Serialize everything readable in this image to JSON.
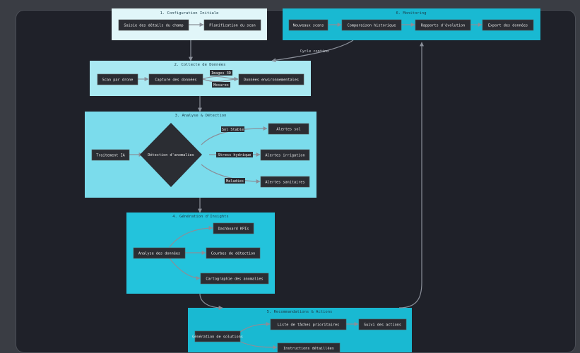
{
  "clusters": {
    "c1": "1. Configuration Initiale",
    "c2": "2. Collecte de Données",
    "c3": "3. Analyse & Détection",
    "c4": "4. Génération d'Insights",
    "c5": "5. Recommandations & Actions",
    "c6": "6. Monitoring"
  },
  "nodes": {
    "saisie": "Saisie des détails du champ",
    "planif": "Planification du scan",
    "scan": "Scan par drone",
    "capture": "Capture des données",
    "envdata": "Données environnementales",
    "traitement": "Traitement IA",
    "anomalies": "Détection d'anomalies",
    "alertes_sol": "Alertes sol",
    "alertes_irr": "Alertes irrigation",
    "alertes_san": "Alertes sanitaires",
    "analyse": "Analyse des données",
    "dashboard": "Dashboard KPIs",
    "courbes": "Courbes de détection",
    "carto": "Cartographie des anomalies",
    "generation": "Génération de solutions",
    "liste": "Liste de tâches prioritaires",
    "suivi": "Suivi des actions",
    "instructions": "Instructions détaillées",
    "nouveaux": "Nouveaux scans",
    "comparaison": "Comparaison historique",
    "rapports": "Rapports d'évolution",
    "export": "Export des données"
  },
  "edge_labels": {
    "images": "Images 3D",
    "mesures": "Mesures",
    "sol_dry": "Sol Stable",
    "stress": "Stress hydrique",
    "maladies": "Maladies",
    "cycle": "Cycle continu"
  },
  "colors": {
    "cluster_light": "#e1f6f9",
    "cluster_mid": "#a9e9f2",
    "cluster_bright": "#7bdcec",
    "cluster_deep": "#23c3dc",
    "cluster_teal": "#19b9d2",
    "node_bg": "#2b2d33",
    "edge": "#8a8f99"
  }
}
